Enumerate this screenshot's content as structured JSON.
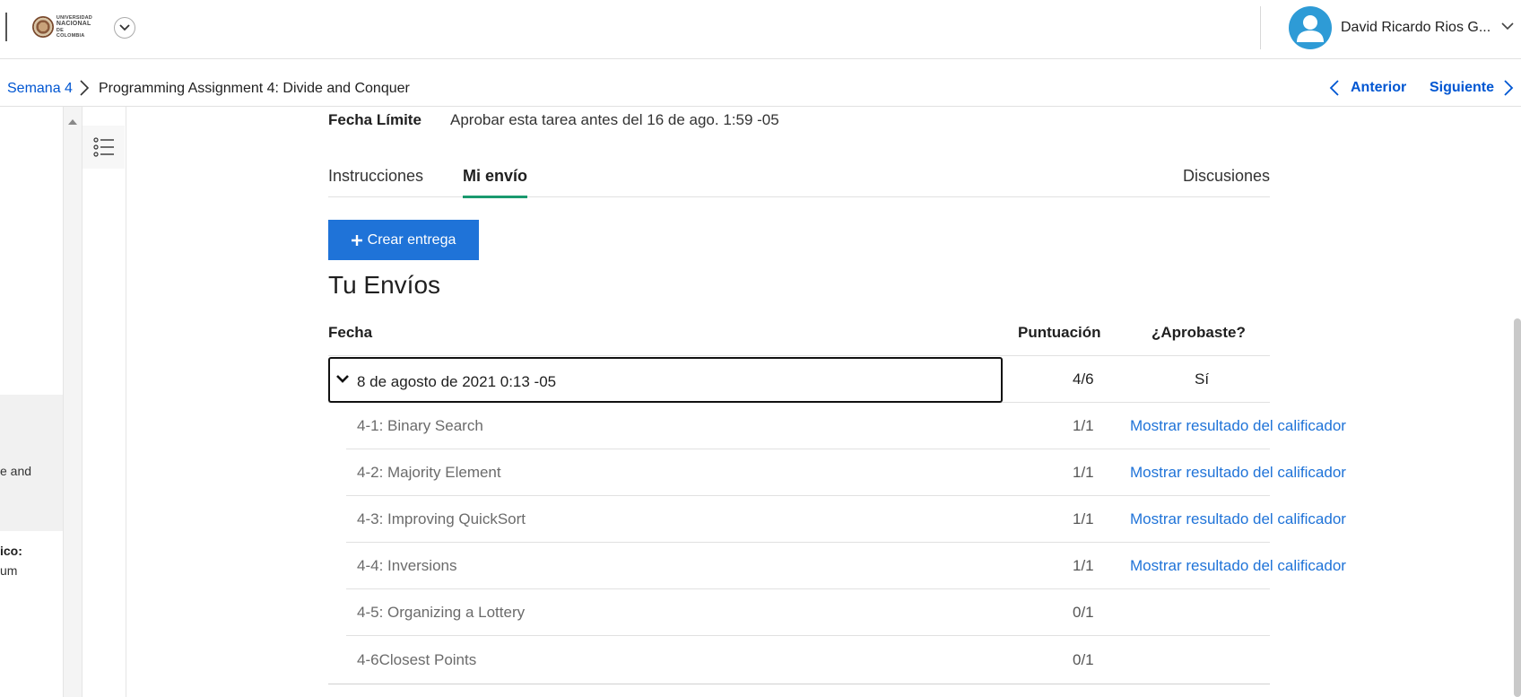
{
  "header": {
    "logo_text": [
      "UNIVERSIDAD",
      "NACIONAL",
      "DE COLOMBIA"
    ],
    "user_name": "David Ricardo Rios G..."
  },
  "breadcrumb": {
    "parent": "Semana 4",
    "current": "Programming Assignment 4: Divide and Conquer"
  },
  "nav": {
    "prev": "Anterior",
    "next": "Siguiente"
  },
  "sidebar_fragments": {
    "text1": "e and",
    "text2": "ico:",
    "text3": "um"
  },
  "deadline": {
    "label": "Fecha Límite",
    "value": "Aprobar esta tarea antes del 16 de ago. 1:59 -05"
  },
  "tabs": {
    "instructions": "Instrucciones",
    "my_submission": "Mi envío",
    "discussions": "Discusiones"
  },
  "create_button": "Crear entrega",
  "section_title": "Tu Envíos",
  "table": {
    "headers": {
      "date": "Fecha",
      "score": "Puntuación",
      "passed": "¿Aprobaste?"
    },
    "submission": {
      "date": "8 de agosto de 2021 0:13 -05",
      "score": "4/6",
      "passed": "Sí"
    },
    "parts": [
      {
        "name": "4-1: Binary Search",
        "score": "1/1",
        "link": "Mostrar resultado del calificador"
      },
      {
        "name": "4-2: Majority Element",
        "score": "1/1",
        "link": "Mostrar resultado del calificador"
      },
      {
        "name": "4-3: Improving QuickSort",
        "score": "1/1",
        "link": "Mostrar resultado del calificador"
      },
      {
        "name": "4-4: Inversions",
        "score": "1/1",
        "link": "Mostrar resultado del calificador"
      },
      {
        "name": "4-5: Organizing a Lottery",
        "score": "0/1",
        "link": ""
      },
      {
        "name": "4-6Closest Points",
        "score": "0/1",
        "link": ""
      }
    ]
  },
  "colors": {
    "link": "#0056d2",
    "primary_button": "#1f73d8",
    "tab_underline": "#1a9a6e",
    "avatar": "#2e9bd6"
  }
}
